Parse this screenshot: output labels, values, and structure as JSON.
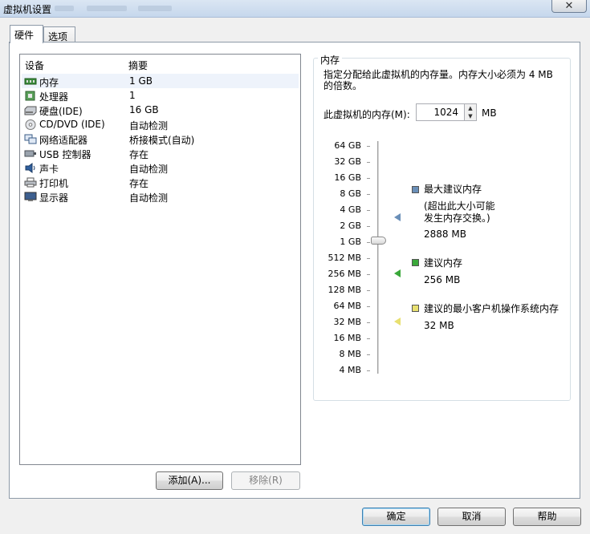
{
  "window": {
    "title": "虚拟机设置",
    "close_icon": "close-icon"
  },
  "tabs": [
    {
      "label": "硬件",
      "active": true
    },
    {
      "label": "选项",
      "active": false
    }
  ],
  "device_list": {
    "headers": {
      "device": "设备",
      "summary": "摘要"
    },
    "rows": [
      {
        "icon": "memory-icon",
        "name": "内存",
        "summary": "1 GB",
        "selected": true
      },
      {
        "icon": "processor-icon",
        "name": "处理器",
        "summary": "1",
        "selected": false
      },
      {
        "icon": "hard-disk-icon",
        "name": "硬盘(IDE)",
        "summary": "16 GB",
        "selected": false
      },
      {
        "icon": "cd-dvd-icon",
        "name": "CD/DVD (IDE)",
        "summary": "自动检测",
        "selected": false
      },
      {
        "icon": "network-adapter-icon",
        "name": "网络适配器",
        "summary": "桥接模式(自动)",
        "selected": false
      },
      {
        "icon": "usb-controller-icon",
        "name": "USB 控制器",
        "summary": "存在",
        "selected": false
      },
      {
        "icon": "sound-card-icon",
        "name": "声卡",
        "summary": "自动检测",
        "selected": false
      },
      {
        "icon": "printer-icon",
        "name": "打印机",
        "summary": "存在",
        "selected": false
      },
      {
        "icon": "display-icon",
        "name": "显示器",
        "summary": "自动检测",
        "selected": false
      }
    ]
  },
  "device_buttons": {
    "add": "添加(A)...",
    "remove": "移除(R)"
  },
  "memory_panel": {
    "group_title": "内存",
    "description": "指定分配给此虚拟机的内存量。内存大小必须为 4 MB 的倍数。",
    "field_label": "此虚拟机的内存(M):",
    "field_value": "1024",
    "field_unit": "MB",
    "slider_ticks": [
      "64 GB",
      "32 GB",
      "16 GB",
      "8 GB",
      "4 GB",
      "2 GB",
      "1 GB",
      "512 MB",
      "256 MB",
      "128 MB",
      "64 MB",
      "32 MB",
      "16 MB",
      "8 MB",
      "4 MB"
    ],
    "slider_value": "1 GB",
    "legend": {
      "max": {
        "label": "最大建议内存",
        "note_line1": "(超出此大小可能",
        "note_line2": "发生内存交换。)",
        "value": "2888 MB",
        "color": "#6a8fb8"
      },
      "recommended": {
        "label": "建议内存",
        "value": "256 MB",
        "color": "#3aa83a"
      },
      "min": {
        "label": "建议的最小客户机操作系统内存",
        "value": "32 MB",
        "color": "#e8e070"
      }
    }
  },
  "footer_buttons": {
    "ok": "确定",
    "cancel": "取消",
    "help": "帮助"
  }
}
